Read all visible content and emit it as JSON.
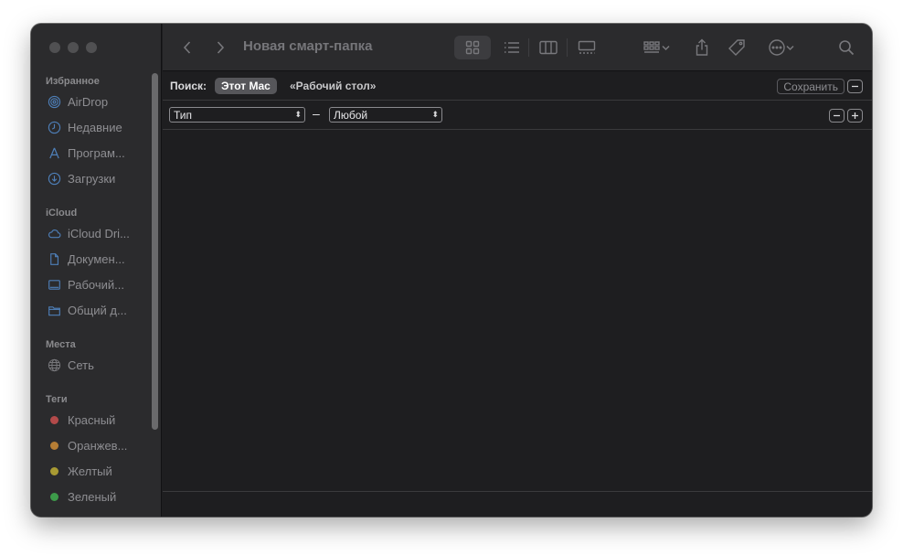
{
  "window": {
    "title": "Новая смарт-папка"
  },
  "sidebar": {
    "sections": [
      {
        "label": "Избранное"
      },
      {
        "label": "iCloud"
      },
      {
        "label": "Места"
      },
      {
        "label": "Теги"
      }
    ],
    "favorites": [
      {
        "label": "AirDrop",
        "icon": "airdrop-icon"
      },
      {
        "label": "Недавние",
        "icon": "clock-icon"
      },
      {
        "label": "Програм...",
        "icon": "applications-icon"
      },
      {
        "label": "Загрузки",
        "icon": "downloads-icon"
      }
    ],
    "icloud": [
      {
        "label": "iCloud Dri...",
        "icon": "cloud-icon"
      },
      {
        "label": "Докумен...",
        "icon": "document-icon"
      },
      {
        "label": "Рабочий...",
        "icon": "desktop-icon"
      },
      {
        "label": "Общий д...",
        "icon": "shared-folder-icon"
      }
    ],
    "places": [
      {
        "label": "Сеть",
        "icon": "network-icon"
      }
    ],
    "tags": [
      {
        "label": "Красный",
        "color": "#b34a4a"
      },
      {
        "label": "Оранжев...",
        "color": "#b57d35"
      },
      {
        "label": "Желтый",
        "color": "#a89a33"
      },
      {
        "label": "Зеленый",
        "color": "#3d9b4a"
      }
    ]
  },
  "scope": {
    "label": "Поиск:",
    "selected": "Этот Mac",
    "other": "«Рабочий стол»",
    "save_label": "Сохранить"
  },
  "criteria": {
    "attribute_value": "Тип",
    "separator": "–",
    "kind_value": "Любой"
  }
}
